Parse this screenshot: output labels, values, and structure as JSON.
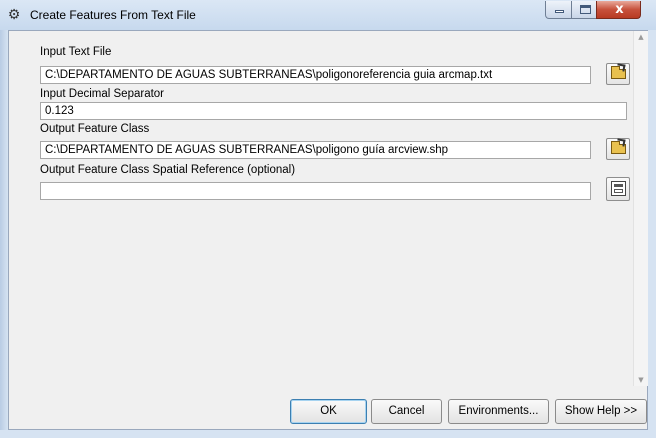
{
  "window": {
    "title": "Create Features From Text File",
    "icon": "tool-icon",
    "controls": {
      "minimize": "minimize-icon",
      "maximize": "maximize-icon",
      "close": "x"
    }
  },
  "form": {
    "input_text_file": {
      "label": "Input Text File",
      "value": "C:\\DEPARTAMENTO DE AGUAS SUBTERRANEAS\\poligonoreferencia guia arcmap.txt",
      "browse_icon": "open-folder-icon"
    },
    "input_decimal_separator": {
      "label": "Input Decimal Separator",
      "value": "0.123"
    },
    "output_feature_class": {
      "label": "Output Feature Class",
      "value": "C:\\DEPARTAMENTO DE AGUAS SUBTERRANEAS\\poligono guía arcview.shp",
      "browse_icon": "open-folder-icon"
    },
    "spatial_reference": {
      "label": "Output Feature Class Spatial Reference (optional)",
      "value": "",
      "properties_icon": "spatial-reference-properties-icon"
    }
  },
  "buttons": {
    "ok": "OK",
    "cancel": "Cancel",
    "environments": "Environments...",
    "show_help": "Show Help >>"
  }
}
